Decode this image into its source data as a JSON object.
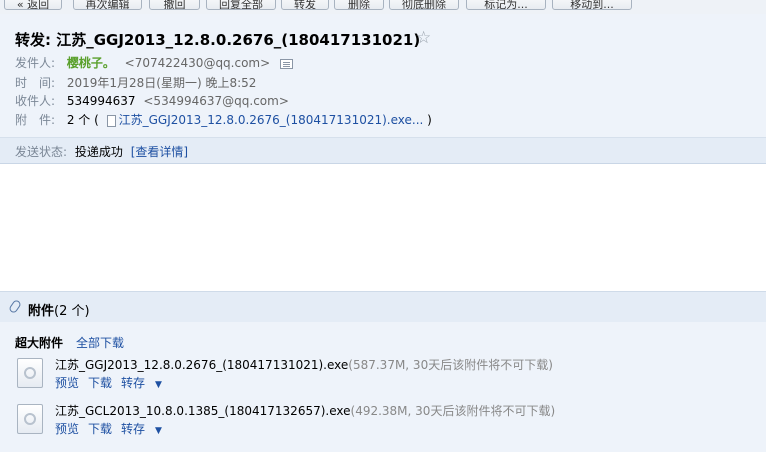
{
  "toolbar": {
    "buttons": [
      "« 返回",
      "再次编辑",
      "撤回",
      "回复全部",
      "转发",
      "删除",
      "彻底删除",
      "标记为...",
      "移动到..."
    ]
  },
  "mail": {
    "subject": "转发: 江苏_GGJ2013_12.8.0.2676_(180417131021)",
    "star": "☆",
    "sender_label": "发件人:",
    "sender_name": "樱桃子。",
    "sender_email": "<707422430@qq.com>",
    "time_label": "时　间:",
    "time_value": "2019年1月28日(星期一) 晚上8:52",
    "to_label": "收件人:",
    "to_name": "534994637",
    "to_email": "<534994637@qq.com>",
    "attach_label": "附　件:",
    "attach_count": "2 个 (",
    "attach_preview": "江苏_GGJ2013_12.8.0.2676_(180417131021).exe...",
    "attach_close": ")",
    "status_label": "发送状态:",
    "status_value": "投递成功",
    "status_link": "[查看详情]"
  },
  "attachments": {
    "title": "附件",
    "count": "(2 个)",
    "section_label": "超大附件",
    "download_all": "全部下载",
    "files": [
      {
        "name": "江苏_GGJ2013_12.8.0.2676_(180417131021).exe",
        "info": "(587.37M, 30天后该附件将不可下载)",
        "preview": "预览",
        "download": "下载",
        "forward": "转存"
      },
      {
        "name": "江苏_GCL2013_10.8.0.1385_(180417132657).exe",
        "info": "(492.38M, 30天后该附件将不可下载)",
        "preview": "预览",
        "download": "下载",
        "forward": "转存"
      }
    ]
  },
  "colors": {
    "accent_link": "#1e50a2",
    "sender_green": "#5aa02c",
    "header_bg": "#eef3fa",
    "status_bg": "#e4ecf6"
  }
}
